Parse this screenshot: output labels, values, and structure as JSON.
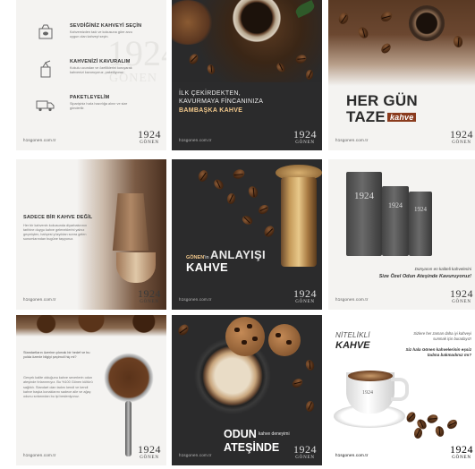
{
  "brand": {
    "logo_number": "1924",
    "logo_name": "GÖNEN",
    "handle": "h1sgonen.com.tr"
  },
  "colors": {
    "accent_gold": "#f3c98c",
    "accent_red": "#8a3b1e",
    "dark_bg": "#2b2b2c",
    "light_bg": "#f4f3f1"
  },
  "tiles": [
    {
      "id": "steps",
      "watermark_number": "1924",
      "watermark_name": "GÖNEN",
      "steps": [
        {
          "icon": "coffee-bean-icon",
          "title": "SEVDİĞİNİZ KAHVEYİ SEÇİN",
          "desc": "Kahvemizden tadı ve kokusuna göre arzu uygun olan kahveyi seçin."
        },
        {
          "icon": "grinder-icon",
          "title": "KAHVENİZİ KAVURALIM",
          "desc": "Kokulu ucundan ve özelliklerini koruyarak kahvenizi kavuruyoruz, paketliyoruz."
        },
        {
          "icon": "delivery-truck-icon",
          "title": "PAKETLEYELİM",
          "desc": "Siparişiniz hızla hazırlığa alınır ve size gönderilir."
        }
      ]
    },
    {
      "id": "first-bean",
      "line1": "İLK ÇEKİRDEKTEN,",
      "line2": "KAVURMAYA FİNCANINIZA",
      "line3": "BAMBAŞKA KAHVE"
    },
    {
      "id": "every-day",
      "line1": "HER GÜN",
      "line2": "TAZE",
      "tag": "kahve"
    },
    {
      "id": "not-just-coffee",
      "title": "SADECE BİR KAHVE DEĞİL",
      "desc": "Her bir kahvenin kokusunda diyarbakırının tarihine duygu kahve geleneklerini yalnız geçmişten, bahçesi yüzyıldan sonra gelen sunumlarından bugüne taşıyoruz."
    },
    {
      "id": "understanding",
      "small_brand": "GÖNEN",
      "small_suffix": "'in",
      "big1": "ANLAYIŞI",
      "big2": "KAHVE"
    },
    {
      "id": "bags",
      "bag_labels": [
        "1924",
        "1924",
        "1924"
      ],
      "line1": "Dünyanın en kaliteli kahvelerini",
      "line2": "Size Özel Odun Ateşinde Kavuruyoruz!"
    },
    {
      "id": "scoop",
      "desc1": "Standartların üzerine çıkmak bir hedef ve bu yolda özenle bilgiyi şeçimcil hiç mi?",
      "desc2": "Gerçek kalite olduğunu kahve severlerin odun ateşinde fırlarınmıyız. Bu %100 Gönen kültürü sağlıklı. Standart olan tadını kendi ve kendi kahve başka konaklarını sadece aile ve ağaç odunu sırlarından bu işi besleniyoruz."
    },
    {
      "id": "fire",
      "big1": "ODUN",
      "sm": "kahve deneyimi",
      "big2": "ATEŞİNDE"
    },
    {
      "id": "quality",
      "title1": "NİTELİKLİ",
      "title2": "KAHVE",
      "right1": "Sizlere her zaman daha iyi kahveyi sunmak için buradayız!",
      "right2": "Siz hala Gönen kahvelerinin eşsiz tadına bakmadınız mı?",
      "cup_logo": "1924"
    }
  ]
}
